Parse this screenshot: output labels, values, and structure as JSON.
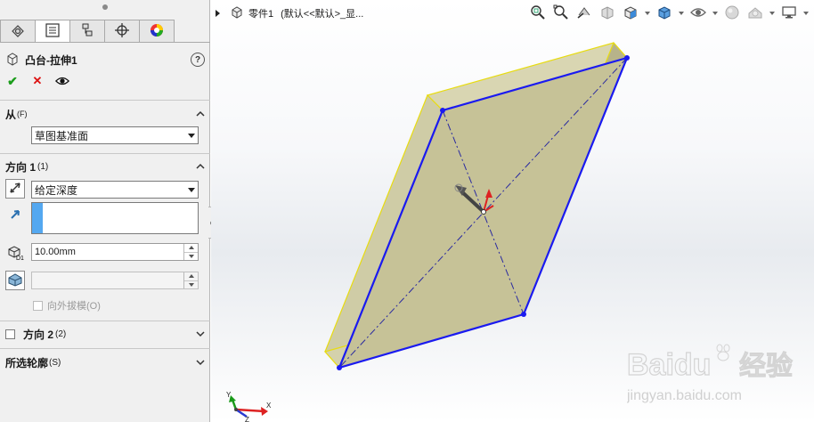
{
  "property_manager": {
    "tabs": [
      {
        "icon": "feature-manager-icon"
      },
      {
        "icon": "property-manager-icon"
      },
      {
        "icon": "configuration-manager-icon"
      },
      {
        "icon": "dimxpert-icon"
      },
      {
        "icon": "display-manager-icon"
      }
    ],
    "feature": {
      "icon": "boss-extrude-icon",
      "title": "凸台-拉伸1",
      "help": "?"
    },
    "actions": {
      "ok": "✔",
      "cancel": "✕",
      "preview": "preview-eye-icon"
    },
    "from": {
      "label": "从",
      "label_suffix": "(F)",
      "start_condition": "草图基准面"
    },
    "direction1": {
      "label": "方向 1",
      "label_suffix": "(1)",
      "end_condition": "给定深度",
      "depth": "10.00mm",
      "draft_outward": "向外拔模(O)"
    },
    "direction2": {
      "label": "方向 2",
      "label_suffix": "(2)"
    },
    "selected_contours": {
      "label": "所选轮廓",
      "label_suffix": "(S)"
    }
  },
  "graphics": {
    "breadcrumb": {
      "part": "零件1",
      "config": "(默认<<默认>_显..."
    },
    "toolbar": [
      "zoom-to-fit-icon",
      "zoom-area-icon",
      "previous-view-icon",
      "section-view-icon",
      "view-orientation-icon",
      "display-style-icon",
      "hide-show-items-icon",
      "edit-appearance-icon",
      "apply-scene-icon",
      "view-settings-icon"
    ],
    "triad": {
      "x": "X",
      "y": "Y",
      "z": "Z"
    },
    "watermark": {
      "brand": "Baidu",
      "brand_cn": "经验",
      "url": "jingyan.baidu.com"
    }
  },
  "colors": {
    "panel_bg": "#f0f0f0",
    "sketch_blue": "#1a1af0",
    "model_face": "#c8c49a",
    "model_edge": "#f0e010",
    "accent_select": "#54a8f0"
  }
}
